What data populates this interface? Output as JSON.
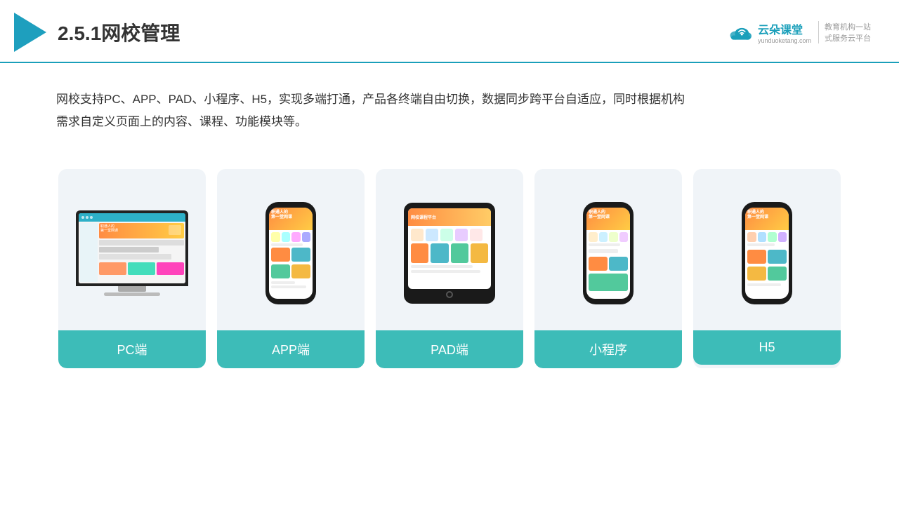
{
  "header": {
    "title": "2.5.1网校管理",
    "brand_name_main": "云朵课堂",
    "brand_name_url": "yunduoketang.com",
    "brand_slogan_line1": "教育机构一站",
    "brand_slogan_line2": "式服务云平台"
  },
  "description": {
    "text_line1": "网校支持PC、APP、PAD、小程序、H5，实现多端打通，产品各终端自由切换，数据同步跨平台自适应，同时根据机构",
    "text_line2": "需求自定义页面上的内容、课程、功能模块等。"
  },
  "devices": [
    {
      "id": "pc",
      "label": "PC端",
      "type": "pc"
    },
    {
      "id": "app",
      "label": "APP端",
      "type": "phone"
    },
    {
      "id": "pad",
      "label": "PAD端",
      "type": "tablet"
    },
    {
      "id": "miniapp",
      "label": "小程序",
      "type": "phone2"
    },
    {
      "id": "h5",
      "label": "H5",
      "type": "phone3"
    }
  ],
  "colors": {
    "accent": "#3dbcb8",
    "header_border": "#1a9fba",
    "card_bg": "#ecf2f8",
    "text_dark": "#333333"
  }
}
